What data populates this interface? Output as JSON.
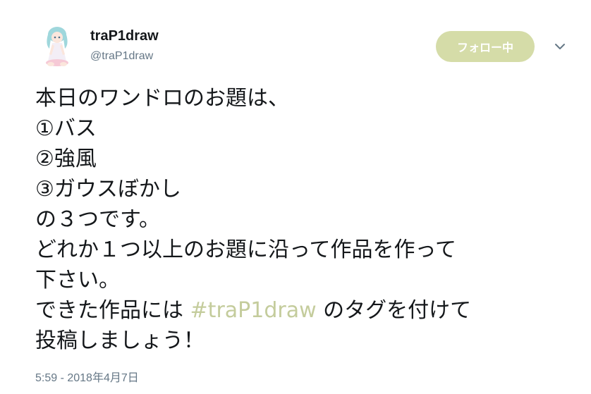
{
  "user": {
    "name": "traP1draw",
    "handle": "@traP1draw"
  },
  "follow_button": {
    "label": "フォロー中"
  },
  "tweet": {
    "lines": [
      "本日のワンドロのお題は、",
      "①バス",
      "②強風",
      "③ガウスぼかし",
      "の３つです。",
      "どれか１つ以上のお題に沿って作品を作って",
      "下さい。"
    ],
    "line8_prefix": "できた作品には ",
    "hashtag": "#traP1draw",
    "line8_suffix": " のタグを付けて",
    "line9": "投稿しましょう！"
  },
  "timestamp": "5:59 - 2018年4月7日",
  "colors": {
    "follow_button_bg": "#d5dca8",
    "hashtag": "#c4cc9c",
    "secondary_text": "#657786"
  },
  "icons": {
    "avatar": "anime-character-avatar",
    "chevron": "chevron-down-icon"
  }
}
